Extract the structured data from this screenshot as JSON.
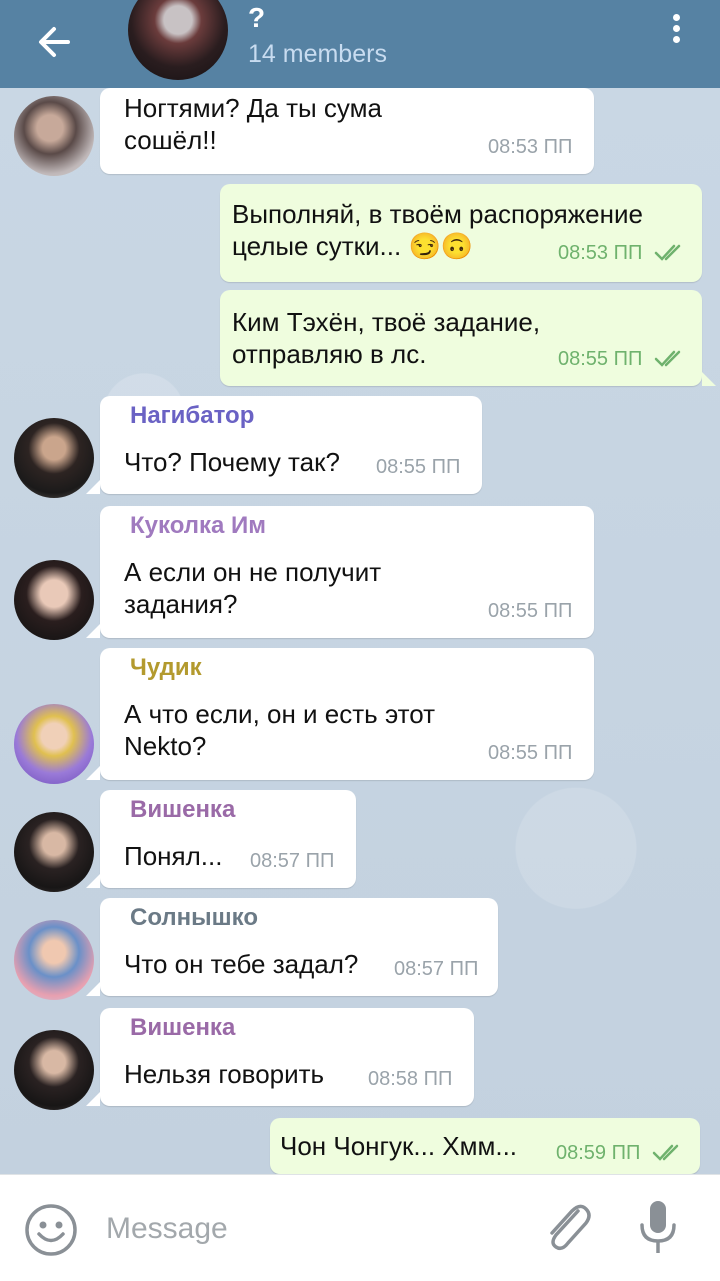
{
  "header": {
    "title": "?",
    "subtitle": "14 members",
    "back_icon": "arrow-left-icon",
    "menu_icon": "more-vertical-icon",
    "color": "#5682a3"
  },
  "messages": [
    {
      "type": "in",
      "sender": "",
      "text_lines": [
        "Ногтями? Да ты сума",
        "сошёл!!"
      ],
      "time": "08:53 ПП"
    },
    {
      "type": "out",
      "text_lines": [
        "Выполняй, в твоём распоряжение",
        "целые сутки... 😏🙃"
      ],
      "time": "08:53 ПП",
      "read": true
    },
    {
      "type": "out",
      "text_lines": [
        "Ким Тэхён, твоё задание,",
        "отправляю в лс."
      ],
      "time": "08:55 ПП",
      "read": true
    },
    {
      "type": "in",
      "sender": "Нагибатор",
      "sender_color": "#6a62c4",
      "text_lines": [
        "Что? Почему так?"
      ],
      "time": "08:55 ПП"
    },
    {
      "type": "in",
      "sender": "Куколка Им",
      "sender_color": "#a07abf",
      "text_lines": [
        "А если он не получит",
        "задания?"
      ],
      "time": "08:55 ПП"
    },
    {
      "type": "in",
      "sender": "Чудик",
      "sender_color": "#b39a2e",
      "text_lines": [
        "А что если, он и есть этот",
        "Nekto?"
      ],
      "time": "08:55 ПП"
    },
    {
      "type": "in",
      "sender": "Вишенка",
      "sender_color": "#9a6aa7",
      "text_lines": [
        "Понял..."
      ],
      "time": "08:57 ПП"
    },
    {
      "type": "in",
      "sender": "Солнышко",
      "sender_color": "#6b7a86",
      "text_lines": [
        "Что он тебе задал?"
      ],
      "time": "08:57 ПП"
    },
    {
      "type": "in",
      "sender": "Вишенка",
      "sender_color": "#9a6aa7",
      "text_lines": [
        "Нельзя говорить"
      ],
      "time": "08:58 ПП"
    },
    {
      "type": "out",
      "text_lines": [
        "Чон Чонгук... Хмм..."
      ],
      "time": "08:59 ПП",
      "read": true
    }
  ],
  "input": {
    "placeholder": "Message",
    "emoji_icon": "smile-icon",
    "attach_icon": "paperclip-icon",
    "mic_icon": "microphone-icon"
  }
}
